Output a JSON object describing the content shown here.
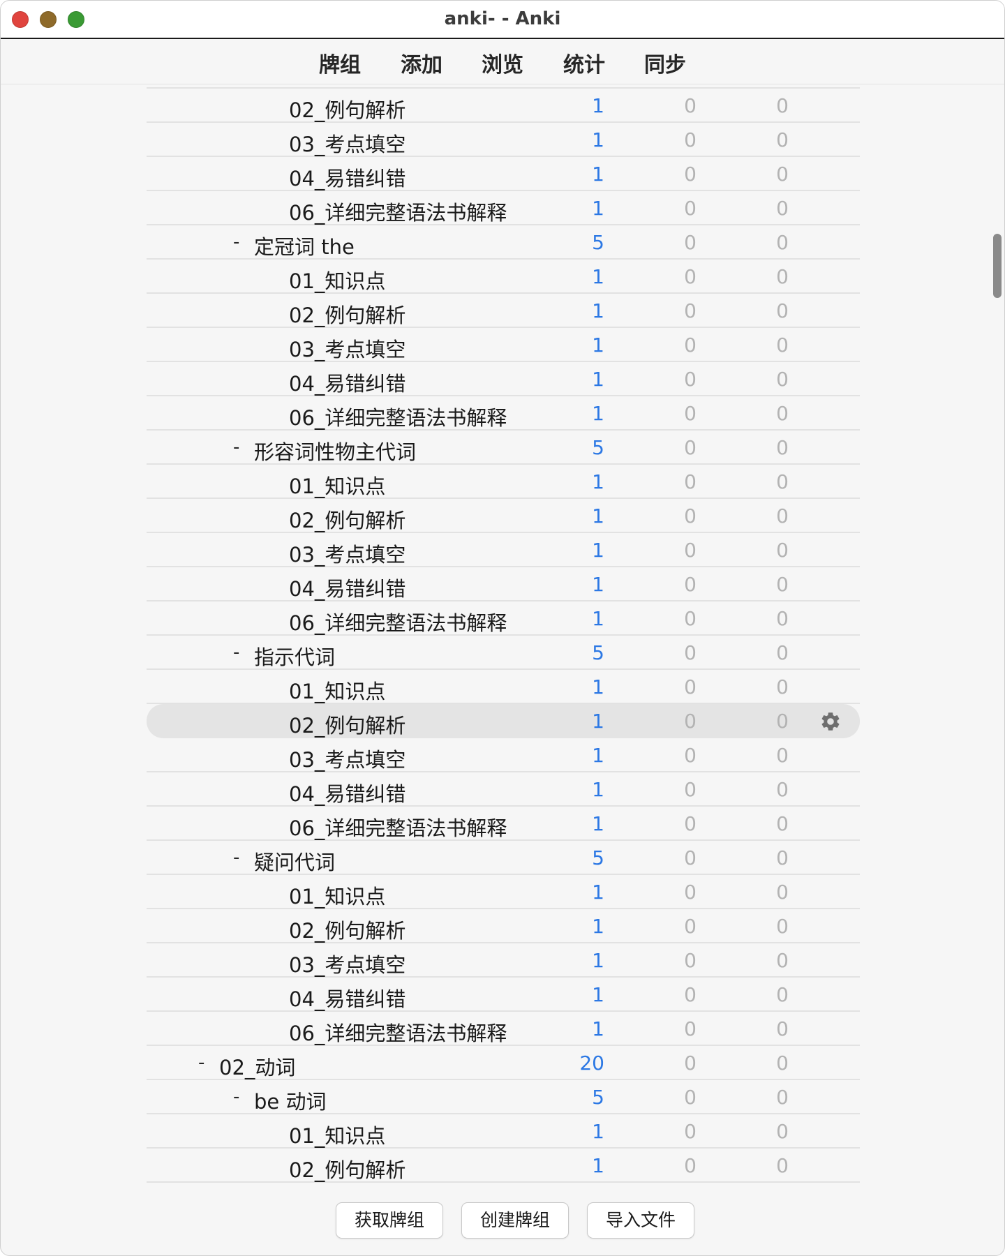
{
  "window": {
    "title": "anki- - Anki"
  },
  "toolbar": {
    "items": [
      "牌组",
      "添加",
      "浏览",
      "统计",
      "同步"
    ]
  },
  "deck_rows": [
    {
      "name": "02_例句解析",
      "level": 3,
      "collapse": "",
      "new": "1",
      "learn": "0",
      "review": "0",
      "current": false
    },
    {
      "name": "03_考点填空",
      "level": 3,
      "collapse": "",
      "new": "1",
      "learn": "0",
      "review": "0",
      "current": false
    },
    {
      "name": "04_易错纠错",
      "level": 3,
      "collapse": "",
      "new": "1",
      "learn": "0",
      "review": "0",
      "current": false
    },
    {
      "name": "06_详细完整语法书解释",
      "level": 3,
      "collapse": "",
      "new": "1",
      "learn": "0",
      "review": "0",
      "current": false
    },
    {
      "name": "定冠词 the",
      "level": 2,
      "collapse": "-",
      "new": "5",
      "learn": "0",
      "review": "0",
      "current": false
    },
    {
      "name": "01_知识点",
      "level": 3,
      "collapse": "",
      "new": "1",
      "learn": "0",
      "review": "0",
      "current": false
    },
    {
      "name": "02_例句解析",
      "level": 3,
      "collapse": "",
      "new": "1",
      "learn": "0",
      "review": "0",
      "current": false
    },
    {
      "name": "03_考点填空",
      "level": 3,
      "collapse": "",
      "new": "1",
      "learn": "0",
      "review": "0",
      "current": false
    },
    {
      "name": "04_易错纠错",
      "level": 3,
      "collapse": "",
      "new": "1",
      "learn": "0",
      "review": "0",
      "current": false
    },
    {
      "name": "06_详细完整语法书解释",
      "level": 3,
      "collapse": "",
      "new": "1",
      "learn": "0",
      "review": "0",
      "current": false
    },
    {
      "name": "形容词性物主代词",
      "level": 2,
      "collapse": "-",
      "new": "5",
      "learn": "0",
      "review": "0",
      "current": false
    },
    {
      "name": "01_知识点",
      "level": 3,
      "collapse": "",
      "new": "1",
      "learn": "0",
      "review": "0",
      "current": false
    },
    {
      "name": "02_例句解析",
      "level": 3,
      "collapse": "",
      "new": "1",
      "learn": "0",
      "review": "0",
      "current": false
    },
    {
      "name": "03_考点填空",
      "level": 3,
      "collapse": "",
      "new": "1",
      "learn": "0",
      "review": "0",
      "current": false
    },
    {
      "name": "04_易错纠错",
      "level": 3,
      "collapse": "",
      "new": "1",
      "learn": "0",
      "review": "0",
      "current": false
    },
    {
      "name": "06_详细完整语法书解释",
      "level": 3,
      "collapse": "",
      "new": "1",
      "learn": "0",
      "review": "0",
      "current": false
    },
    {
      "name": "指示代词",
      "level": 2,
      "collapse": "-",
      "new": "5",
      "learn": "0",
      "review": "0",
      "current": false
    },
    {
      "name": "01_知识点",
      "level": 3,
      "collapse": "",
      "new": "1",
      "learn": "0",
      "review": "0",
      "current": false
    },
    {
      "name": "02_例句解析",
      "level": 3,
      "collapse": "",
      "new": "1",
      "learn": "0",
      "review": "0",
      "current": true
    },
    {
      "name": "03_考点填空",
      "level": 3,
      "collapse": "",
      "new": "1",
      "learn": "0",
      "review": "0",
      "current": false
    },
    {
      "name": "04_易错纠错",
      "level": 3,
      "collapse": "",
      "new": "1",
      "learn": "0",
      "review": "0",
      "current": false
    },
    {
      "name": "06_详细完整语法书解释",
      "level": 3,
      "collapse": "",
      "new": "1",
      "learn": "0",
      "review": "0",
      "current": false
    },
    {
      "name": "疑问代词",
      "level": 2,
      "collapse": "-",
      "new": "5",
      "learn": "0",
      "review": "0",
      "current": false
    },
    {
      "name": "01_知识点",
      "level": 3,
      "collapse": "",
      "new": "1",
      "learn": "0",
      "review": "0",
      "current": false
    },
    {
      "name": "02_例句解析",
      "level": 3,
      "collapse": "",
      "new": "1",
      "learn": "0",
      "review": "0",
      "current": false
    },
    {
      "name": "03_考点填空",
      "level": 3,
      "collapse": "",
      "new": "1",
      "learn": "0",
      "review": "0",
      "current": false
    },
    {
      "name": "04_易错纠错",
      "level": 3,
      "collapse": "",
      "new": "1",
      "learn": "0",
      "review": "0",
      "current": false
    },
    {
      "name": "06_详细完整语法书解释",
      "level": 3,
      "collapse": "",
      "new": "1",
      "learn": "0",
      "review": "0",
      "current": false
    },
    {
      "name": "02_动词",
      "level": 1,
      "collapse": "-",
      "new": "20",
      "learn": "0",
      "review": "0",
      "current": false
    },
    {
      "name": "be 动词",
      "level": 2,
      "collapse": "-",
      "new": "5",
      "learn": "0",
      "review": "0",
      "current": false
    },
    {
      "name": "01_知识点",
      "level": 3,
      "collapse": "",
      "new": "1",
      "learn": "0",
      "review": "0",
      "current": false
    },
    {
      "name": "02_例句解析",
      "level": 3,
      "collapse": "",
      "new": "1",
      "learn": "0",
      "review": "0",
      "current": false
    }
  ],
  "gear_icon": "gear-icon",
  "bottom_buttons": [
    "获取牌组",
    "创建牌组",
    "导入文件"
  ],
  "colors": {
    "new_count": "#2c78e4",
    "zero_count": "#b3b3b3",
    "current_row": "#e4e4e4"
  }
}
